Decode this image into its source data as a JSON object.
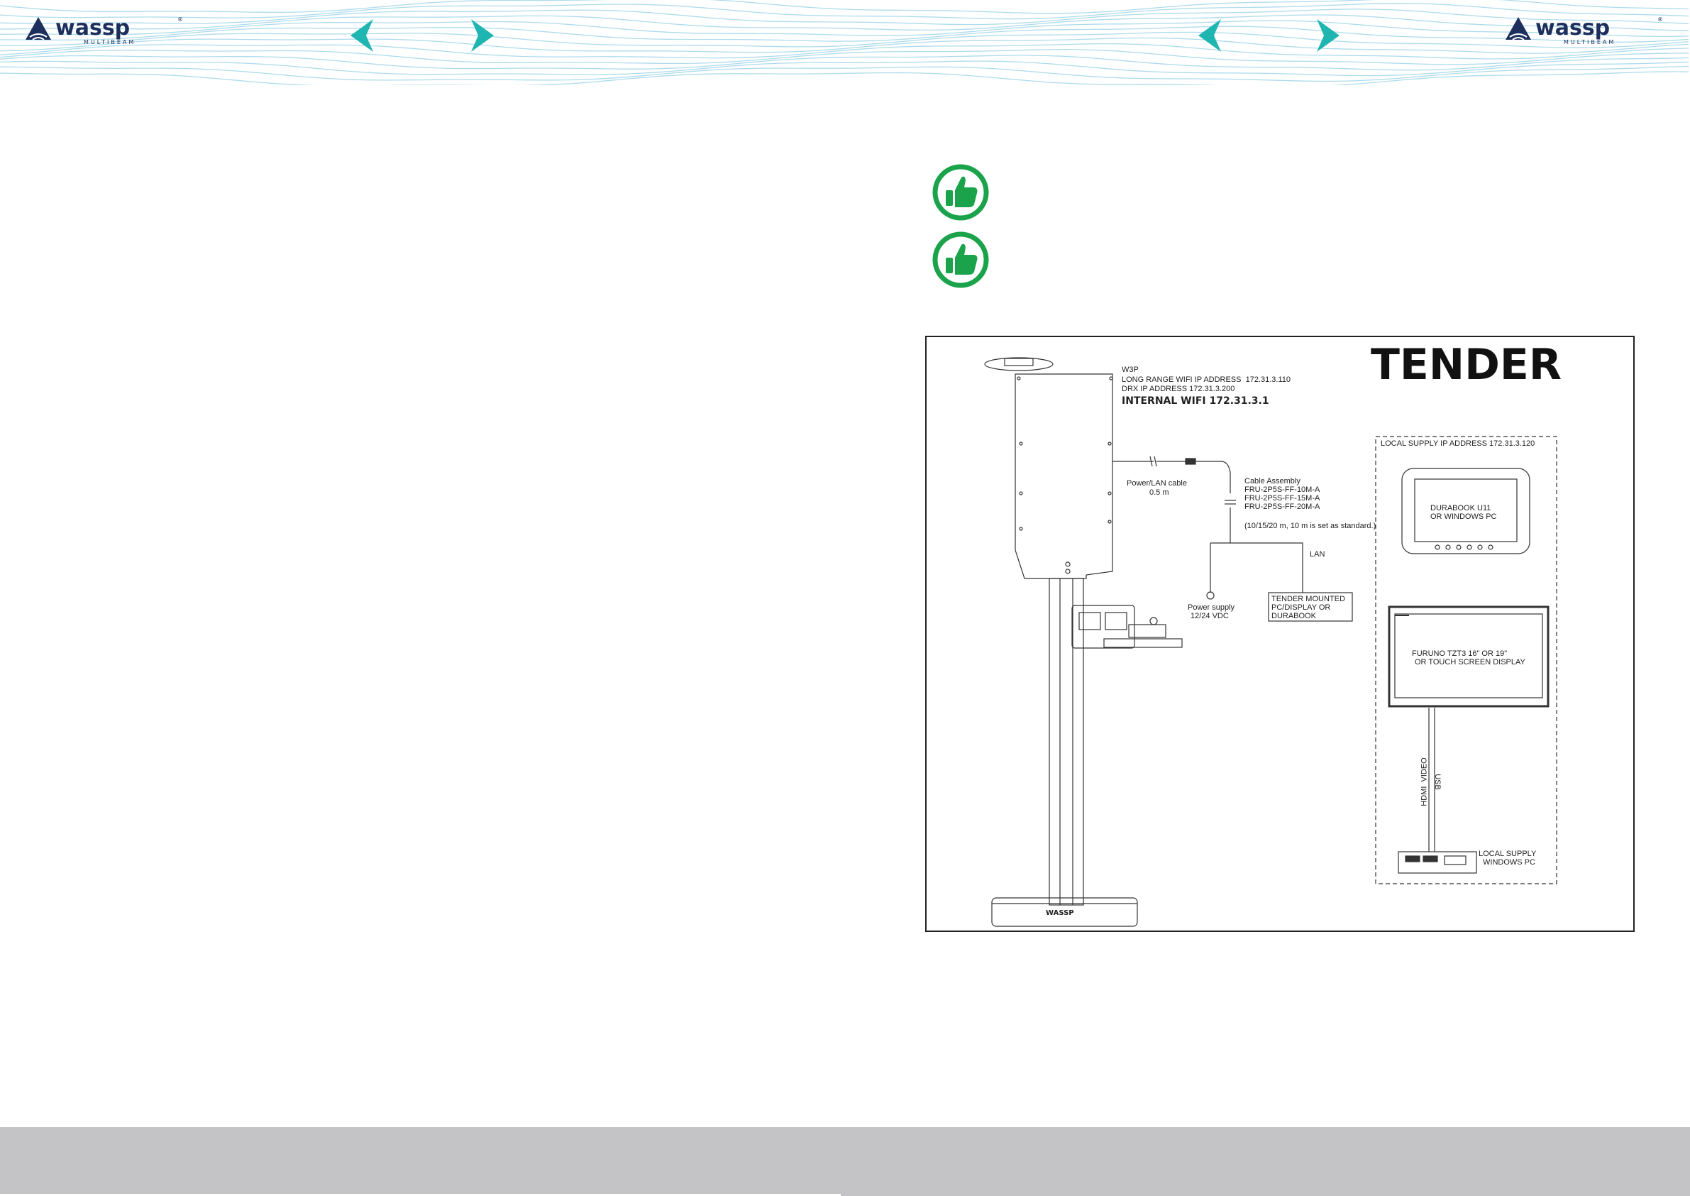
{
  "header": {
    "brand": "wassp",
    "brand_sub": "MULTIBEAM",
    "brand_mark": "®"
  },
  "colors": {
    "accent_teal": "#1fb5b0",
    "brand_navy": "#1d2f5c",
    "wave_lines": "#9fd5e8",
    "thumb_green": "#1aa34a",
    "footer_gray": "#c4c4c6"
  },
  "icons": [
    "logo-icon",
    "prev-arrow-icon",
    "next-arrow-icon",
    "thumbs-up-icon"
  ],
  "diagram": {
    "title": "TENDER",
    "w3p_label": "W3P",
    "w3p_line1": "LONG RANGE WIFI IP ADDRESS  172.31.3.110",
    "w3p_line2": "DRX IP ADDRESS 172.31.3.200",
    "internal_wifi": "INTERNAL WIFI 172.31.3.1",
    "power_lan_cable": "Power/LAN cable",
    "power_lan_length": "0.5 m",
    "cable_assembly": "Cable Assembly",
    "cable_part_1": "FRU-2P5S-FF-10M-A",
    "cable_part_2": "FRU-2P5S-FF-15M-A",
    "cable_part_3": "FRU-2P5S-FF-20M-A",
    "cable_note": "(10/15/20 m, 10 m is set as standard.)",
    "lan_label": "LAN",
    "power_supply": "Power supply",
    "power_voltage": "12/24 VDC",
    "tender_pc_1": "TENDER MOUNTED",
    "tender_pc_2": "PC/DISPLAY OR",
    "tender_pc_3": "DURABOOK",
    "local_supply_ip": "LOCAL SUPPLY IP ADDRESS 172.31.3.120",
    "durabook_1": "DURABOOK U11",
    "durabook_2": "OR WINDOWS PC",
    "furuno_1": "FURUNO TZT3 16\" OR 19\"",
    "furuno_2": "OR TOUCH SCREEN DISPLAY",
    "hdmi_label": "HDMI  VIDEO",
    "usb_label": "USB",
    "local_pc_1": "LOCAL SUPPLY",
    "local_pc_2": "WINDOWS PC",
    "stand_logo": "WASSP"
  }
}
